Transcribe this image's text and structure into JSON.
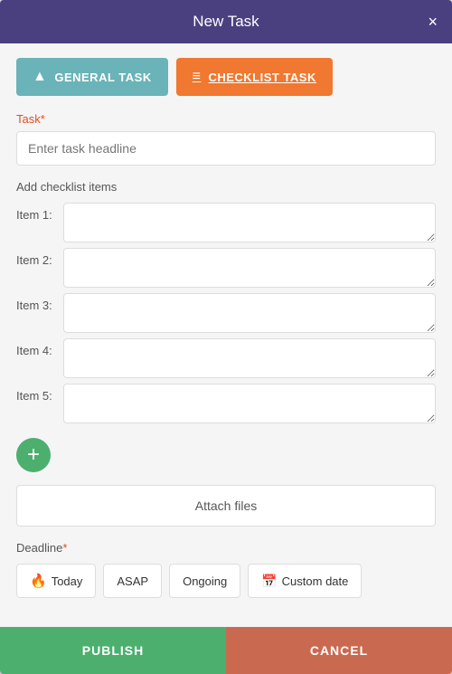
{
  "modal": {
    "title": "New Task",
    "close_icon": "×"
  },
  "tabs": {
    "general": {
      "label": "GENERAL TASK",
      "icon": "▲"
    },
    "checklist": {
      "label": "CHECKLIST TASK",
      "icon": "≡"
    }
  },
  "form": {
    "task_label": "Task",
    "task_required": "*",
    "task_placeholder": "Enter task headline",
    "checklist_label": "Add checklist items",
    "items": [
      {
        "label": "Item 1:"
      },
      {
        "label": "Item 2:"
      },
      {
        "label": "Item 3:"
      },
      {
        "label": "Item 4:"
      },
      {
        "label": "Item 5:"
      }
    ],
    "add_btn_icon": "+",
    "attach_label": "Attach files",
    "deadline_label": "Deadline",
    "deadline_required": "*",
    "deadline_options": [
      {
        "label": "Today",
        "icon": "fire"
      },
      {
        "label": "ASAP"
      },
      {
        "label": "Ongoing"
      },
      {
        "label": "Custom date",
        "icon": "calendar"
      }
    ]
  },
  "footer": {
    "publish_label": "PUBLISH",
    "cancel_label": "CANCEL"
  },
  "colors": {
    "header_bg": "#4a4080",
    "general_tab": "#6ab3b8",
    "checklist_tab": "#f07830",
    "publish_btn": "#4caf6e",
    "cancel_btn": "#c96a50",
    "add_btn": "#4caf6e"
  }
}
